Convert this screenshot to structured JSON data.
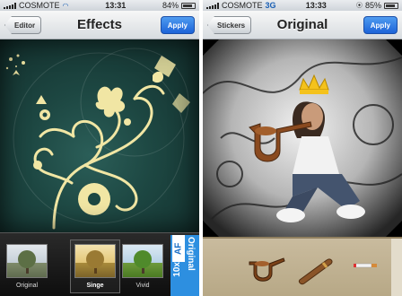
{
  "left": {
    "status": {
      "carrier": "COSMOTE",
      "network": "",
      "time": "13:31",
      "battery": "84%",
      "battery_level": 0.84
    },
    "nav": {
      "back": "Editor",
      "title": "Effects",
      "apply": "Apply"
    },
    "thumbnails": [
      {
        "label": "Original",
        "selected": false
      },
      {
        "label": "Singe",
        "selected": true
      },
      {
        "label": "Vivid",
        "selected": false
      }
    ],
    "badge": {
      "af": "AF",
      "tenx": "10x",
      "original": "Original"
    }
  },
  "right": {
    "status": {
      "carrier": "COSMOTE",
      "network": "3G",
      "time": "13:33",
      "battery": "85%",
      "battery_level": 0.85
    },
    "nav": {
      "back": "Stickers",
      "title": "Original",
      "apply": "Apply"
    },
    "stickers": [
      "pipe-sticker",
      "cigar-sticker",
      "cigarette-sticker"
    ]
  },
  "colors": {
    "apply_blue": "#1d63d8",
    "canvas_teal": "#1d4742",
    "ornament_gold": "#f1e6a4"
  }
}
